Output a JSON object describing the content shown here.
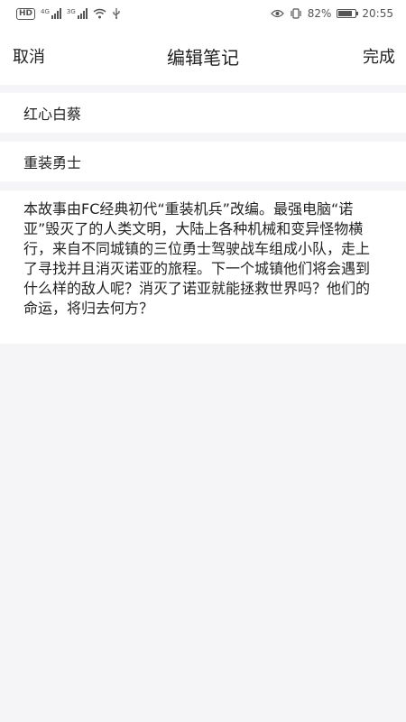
{
  "status_bar": {
    "hd_badge": "HD",
    "signal1_label": "4G",
    "signal2_label": "3G",
    "battery_text": "82%",
    "battery_level": 0.82,
    "time": "20:55",
    "icons": [
      "hd-icon",
      "signal-icon",
      "wifi-icon",
      "usb-icon",
      "eye-icon",
      "vibrate-icon",
      "battery-icon"
    ]
  },
  "navbar": {
    "cancel_label": "取消",
    "title": "编辑笔记",
    "done_label": "完成"
  },
  "note": {
    "title": "红心白蔡",
    "subtitle": "重装勇士",
    "body": "本故事由FC经典初代“重装机兵”改编。最强电脑“诺亚”毁灭了的人类文明，大陆上各种机械和变异怪物横行，来自不同城镇的三位勇士驾驶战车组成小队，走上了寻找并且消灭诺亚的旅程。下一个城镇他们将会遇到什么样的敌人呢？消灭了诺亚就能拯救世界吗？他们的命运，将归去何方？"
  },
  "colors": {
    "background": "#f5f5f7",
    "surface": "#ffffff",
    "text": "#222222",
    "status_text": "#555555"
  }
}
